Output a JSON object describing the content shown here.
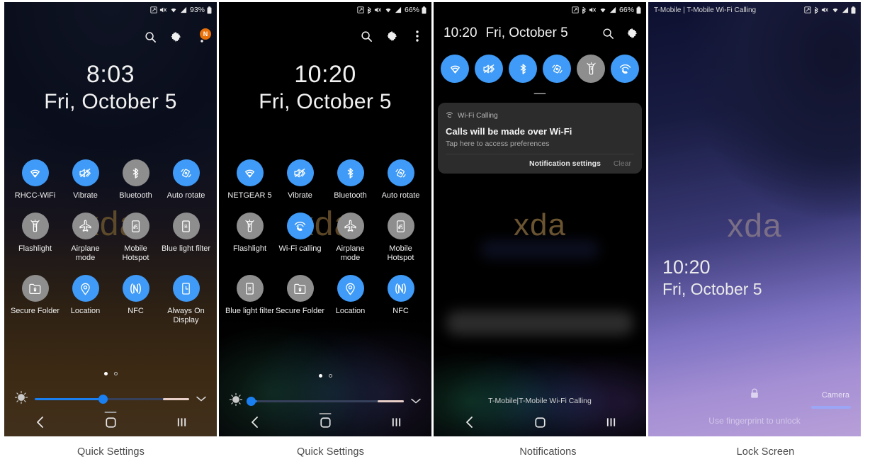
{
  "captions": [
    "Quick Settings",
    "Quick Settings",
    "Notifications",
    "Lock Screen"
  ],
  "colors": {
    "accent_on": "#3f9bf7",
    "accent_off": "#8e8e8e",
    "badge": "#e8710a",
    "slider_fill": "#1a7ff0",
    "watermark": "#6b5430"
  },
  "panels": [
    {
      "id": "quick-settings-1",
      "status_bar": {
        "left_text": "",
        "icons": [
          "nfc-icon",
          "mute-icon",
          "wifi-icon",
          "signal-icon"
        ],
        "battery_percent": "93%",
        "battery_icon": "battery-icon"
      },
      "header": {
        "search_icon": "search-icon",
        "settings_icon": "gear-icon",
        "overflow_icon": "overflow-menu-icon",
        "badge_label": "N"
      },
      "clock": {
        "time": "8:03",
        "date": "Fri, October 5"
      },
      "watermark": "xda",
      "tiles": [
        {
          "label": "RHCC-WiFi",
          "icon": "wifi-icon",
          "state": "on"
        },
        {
          "label": "Vibrate",
          "icon": "vibrate-icon",
          "state": "on"
        },
        {
          "label": "Bluetooth",
          "icon": "bluetooth-icon",
          "state": "off"
        },
        {
          "label": "Auto rotate",
          "icon": "auto-rotate-icon",
          "state": "on"
        },
        {
          "label": "Flashlight",
          "icon": "flashlight-icon",
          "state": "off"
        },
        {
          "label": "Airplane mode",
          "icon": "airplane-icon",
          "state": "off"
        },
        {
          "label": "Mobile Hotspot",
          "icon": "hotspot-icon",
          "state": "off"
        },
        {
          "label": "Blue light filter",
          "icon": "blue-light-icon",
          "state": "off"
        },
        {
          "label": "Secure Folder",
          "icon": "secure-folder-icon",
          "state": "off"
        },
        {
          "label": "Location",
          "icon": "location-icon",
          "state": "on"
        },
        {
          "label": "NFC",
          "icon": "nfc-icon",
          "state": "on"
        },
        {
          "label": "Always On Display",
          "icon": "always-on-icon",
          "state": "on"
        }
      ],
      "pager": {
        "pages": 2,
        "current": 1
      },
      "brightness": {
        "value_percent": 44,
        "icon": "brightness-icon",
        "expand_icon": "chevron-down-icon"
      },
      "navbar": {
        "back": "back-icon",
        "home": "home-icon",
        "recents": "recents-icon"
      }
    },
    {
      "id": "quick-settings-2",
      "status_bar": {
        "left_text": "",
        "icons": [
          "nfc-icon",
          "bluetooth-icon",
          "mute-icon",
          "wifi-icon",
          "signal-icon"
        ],
        "battery_percent": "66%",
        "battery_icon": "battery-icon"
      },
      "header": {
        "search_icon": "search-icon",
        "settings_icon": "gear-icon",
        "overflow_icon": "overflow-menu-icon",
        "badge_label": ""
      },
      "clock": {
        "time": "10:20",
        "date": "Fri, October 5"
      },
      "watermark": "xda",
      "tiles": [
        {
          "label": "NETGEAR 5",
          "icon": "wifi-icon",
          "state": "on"
        },
        {
          "label": "Vibrate",
          "icon": "vibrate-icon",
          "state": "on"
        },
        {
          "label": "Bluetooth",
          "icon": "bluetooth-icon",
          "state": "on"
        },
        {
          "label": "Auto rotate",
          "icon": "auto-rotate-icon",
          "state": "on"
        },
        {
          "label": "Flashlight",
          "icon": "flashlight-icon",
          "state": "off"
        },
        {
          "label": "Wi-Fi calling",
          "icon": "wifi-calling-icon",
          "state": "on"
        },
        {
          "label": "Airplane mode",
          "icon": "airplane-icon",
          "state": "off"
        },
        {
          "label": "Mobile Hotspot",
          "icon": "hotspot-icon",
          "state": "off"
        },
        {
          "label": "Blue light filter",
          "icon": "blue-light-icon",
          "state": "off"
        },
        {
          "label": "Secure Folder",
          "icon": "secure-folder-icon",
          "state": "off"
        },
        {
          "label": "Location",
          "icon": "location-icon",
          "state": "on"
        },
        {
          "label": "NFC",
          "icon": "nfc-icon",
          "state": "on"
        }
      ],
      "pager": {
        "pages": 2,
        "current": 1
      },
      "brightness": {
        "value_percent": 5,
        "icon": "brightness-icon",
        "expand_icon": "chevron-down-icon"
      },
      "navbar": {
        "back": "back-icon",
        "home": "home-icon",
        "recents": "recents-icon"
      }
    },
    {
      "id": "notifications",
      "status_bar": {
        "left_text": "",
        "icons": [
          "nfc-icon",
          "bluetooth-icon",
          "mute-icon",
          "wifi-icon",
          "signal-icon"
        ],
        "battery_percent": "66%",
        "battery_icon": "battery-icon"
      },
      "header_row": {
        "time": "10:20",
        "date": "Fri, October 5",
        "search_icon": "search-icon",
        "settings_icon": "gear-icon"
      },
      "quick_toggles": [
        {
          "icon": "wifi-icon",
          "state": "on"
        },
        {
          "icon": "vibrate-icon",
          "state": "on"
        },
        {
          "icon": "bluetooth-icon",
          "state": "on"
        },
        {
          "icon": "auto-rotate-icon",
          "state": "on"
        },
        {
          "icon": "flashlight-icon",
          "state": "off"
        },
        {
          "icon": "wifi-calling-icon",
          "state": "on"
        }
      ],
      "watermark": "xda",
      "notification": {
        "app_icon": "wifi-calling-icon",
        "app_name": "Wi-Fi Calling",
        "title": "Calls will be made over Wi-Fi",
        "subtitle": "Tap here to access preferences",
        "action_primary": "Notification settings",
        "action_secondary": "Clear"
      },
      "carrier_footer": "T-Mobile|T-Mobile Wi-Fi Calling",
      "navbar": {
        "back": "back-icon",
        "home": "home-icon",
        "recents": "recents-icon"
      }
    },
    {
      "id": "lock-screen",
      "status_bar": {
        "left_text": "T-Mobile | T-Mobile Wi-Fi Calling",
        "icons": [
          "nfc-icon",
          "bluetooth-icon",
          "mute-icon",
          "wifi-icon",
          "signal-icon"
        ],
        "battery_percent": "",
        "battery_icon": "battery-icon"
      },
      "watermark": "xda",
      "clock": {
        "time": "10:20",
        "date": "Fri, October 5"
      },
      "lock_icon": "lock-icon",
      "hint": "Use fingerprint to unlock",
      "camera_label": "Camera"
    }
  ]
}
